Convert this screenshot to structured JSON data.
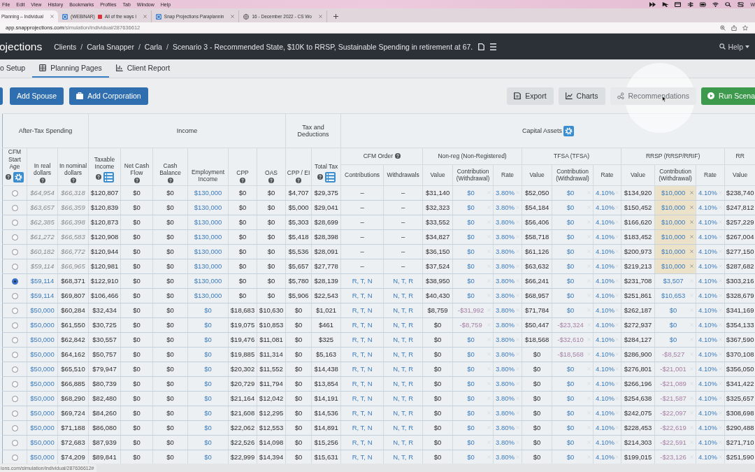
{
  "menu_bar": {
    "items": [
      "File",
      "Edit",
      "View",
      "History",
      "Bookmarks",
      "Profiles",
      "Tab",
      "Window",
      "Help"
    ],
    "status_text": "W"
  },
  "browser_tabs": [
    {
      "title_parts": [
        "Planning – Individual"
      ],
      "selected": true
    },
    {
      "title_parts": [
        "(WEBINAR)",
        "All of the ways i"
      ],
      "selected": false
    },
    {
      "title_parts": [
        "Snap Projections Paraplannin"
      ],
      "selected": false
    },
    {
      "title_parts": [
        "16 - December 2022 - CS Wo"
      ],
      "selected": false
    }
  ],
  "address_bar": {
    "host": "app.snapprojections.com",
    "path": "/simulation/individual/287636612"
  },
  "app_header": {
    "logo": "ojections",
    "breadcrumb": [
      {
        "label": "Clients",
        "separator": "/"
      },
      {
        "label": "Carla Snapper",
        "separator": "/"
      },
      {
        "label": "Carla",
        "separator": "/"
      },
      {
        "label": "Scenario 3 - Recommended State, $10K to RRSP, Sustainable Spending in retirement at 67."
      }
    ],
    "help": "Help"
  },
  "nav_tabs": [
    {
      "label": "o Setup",
      "selected": false
    },
    {
      "label": "Planning Pages",
      "selected": true
    },
    {
      "label": "Client Report",
      "selected": false
    }
  ],
  "toolbar": {
    "left": [
      {
        "label": "Add Spouse"
      },
      {
        "label": "Add Corporation"
      }
    ],
    "right": [
      {
        "label": "Export",
        "kind": "secondary",
        "disabled": false
      },
      {
        "label": "Charts",
        "kind": "secondary",
        "disabled": false
      },
      {
        "label": "Recommendations",
        "kind": "secondary",
        "disabled": true
      },
      {
        "label": "Run Scena",
        "kind": "success",
        "disabled": false
      }
    ]
  },
  "table": {
    "groups": [
      {
        "label": "After-Tax Spending",
        "columns": [
          {
            "label": "CFM Start Age",
            "help": true,
            "kind": "radio"
          },
          {
            "label": "In real dollars",
            "help": true,
            "kind": "spending"
          },
          {
            "label": "In nominal dollars",
            "help": true,
            "kind": "nominal"
          }
        ]
      },
      {
        "label": "Income",
        "columns": [
          {
            "label": "Taxable Income",
            "help": true,
            "kind": "amount"
          },
          {
            "label": "Net Cash Flow",
            "help": true,
            "kind": "amount"
          },
          {
            "label": "Cash Balance",
            "help": true,
            "kind": "amount"
          },
          {
            "label": "Employment Income",
            "help": false,
            "kind": "input"
          },
          {
            "label": "CPP",
            "help": true,
            "kind": "amount"
          },
          {
            "label": "OAS",
            "help": true,
            "kind": "amount"
          }
        ]
      },
      {
        "label": "Tax and Deductions",
        "columns": [
          {
            "label": "CPP / EI",
            "help": true,
            "kind": "amount"
          },
          {
            "label": "Total Tax",
            "help": true,
            "kind": "amount"
          }
        ]
      },
      {
        "label": "Capital Assets",
        "subgroups": [
          {
            "label": "CFM Order",
            "help": true,
            "columns": [
              {
                "label": "Contributions",
                "kind": "order"
              },
              {
                "label": "Withdrawals",
                "kind": "order"
              }
            ]
          },
          {
            "label": "Non-reg (Non-Registered)",
            "help": false,
            "columns": [
              {
                "label": "Value",
                "kind": "amount"
              },
              {
                "label": "Contribution (Withdrawal)",
                "kind": "contribution"
              },
              {
                "label": "Rate",
                "kind": "rate"
              }
            ]
          },
          {
            "label": "TFSA (TFSA)",
            "help": false,
            "columns": [
              {
                "label": "Value",
                "kind": "amount"
              },
              {
                "label": "Contribution (Withdrawal)",
                "kind": "contribution"
              },
              {
                "label": "Rate",
                "kind": "rate"
              }
            ]
          },
          {
            "label": "RRSP (RRSP/RRIF)",
            "help": false,
            "columns": [
              {
                "label": "Value",
                "kind": "amount"
              },
              {
                "label": "Contribution (Withdrawal)",
                "kind": "contribution"
              },
              {
                "label": "Rate",
                "kind": "rate"
              }
            ]
          },
          {
            "label": "RR",
            "help": false,
            "columns": [
              {
                "label": "Value",
                "kind": "amount"
              }
            ]
          }
        ]
      }
    ],
    "rows": [
      {
        "selected": false,
        "before_start": true,
        "cells": [
          "$64,954",
          "$66,318",
          "$120,807",
          "$0",
          "$0",
          "$130,000",
          "$0",
          "$0",
          "$4,707",
          "$29,375",
          "–",
          "–",
          "$31,140",
          {
            "value": "$0",
            "withdrawal": false,
            "override": false
          },
          "3.80%",
          "$52,050",
          {
            "value": "$0",
            "withdrawal": false,
            "override": false
          },
          "4.10%",
          "$134,920",
          {
            "value": "$10,000",
            "withdrawal": false,
            "override": true
          },
          "4.10%",
          "$238,740"
        ]
      },
      {
        "selected": false,
        "before_start": true,
        "cells": [
          "$63,657",
          "$66,359",
          "$120,839",
          "$0",
          "$0",
          "$130,000",
          "$0",
          "$0",
          "$5,000",
          "$29,041",
          "–",
          "–",
          "$32,323",
          {
            "value": "$0",
            "withdrawal": false,
            "override": false
          },
          "3.80%",
          "$54,184",
          {
            "value": "$0",
            "withdrawal": false,
            "override": false
          },
          "4.10%",
          "$150,452",
          {
            "value": "$10,000",
            "withdrawal": false,
            "override": true
          },
          "4.10%",
          "$247,812"
        ]
      },
      {
        "selected": false,
        "before_start": true,
        "cells": [
          "$62,385",
          "$66,398",
          "$120,873",
          "$0",
          "$0",
          "$130,000",
          "$0",
          "$0",
          "$5,303",
          "$28,699",
          "–",
          "–",
          "$33,552",
          {
            "value": "$0",
            "withdrawal": false,
            "override": false
          },
          "3.80%",
          "$56,406",
          {
            "value": "$0",
            "withdrawal": false,
            "override": false
          },
          "4.10%",
          "$166,620",
          {
            "value": "$10,000",
            "withdrawal": false,
            "override": true
          },
          "4.10%",
          "$257,229"
        ]
      },
      {
        "selected": false,
        "before_start": true,
        "cells": [
          "$61,272",
          "$66,583",
          "$120,908",
          "$0",
          "$0",
          "$130,000",
          "$0",
          "$0",
          "$5,418",
          "$28,398",
          "–",
          "–",
          "$34,827",
          {
            "value": "$0",
            "withdrawal": false,
            "override": false
          },
          "3.80%",
          "$58,718",
          {
            "value": "$0",
            "withdrawal": false,
            "override": false
          },
          "4.10%",
          "$183,452",
          {
            "value": "$10,000",
            "withdrawal": false,
            "override": true
          },
          "4.10%",
          "$267,004"
        ]
      },
      {
        "selected": false,
        "before_start": true,
        "cells": [
          "$60,182",
          "$66,772",
          "$120,944",
          "$0",
          "$0",
          "$130,000",
          "$0",
          "$0",
          "$5,536",
          "$28,091",
          "–",
          "–",
          "$36,150",
          {
            "value": "$0",
            "withdrawal": false,
            "override": false
          },
          "3.80%",
          "$61,126",
          {
            "value": "$0",
            "withdrawal": false,
            "override": false
          },
          "4.10%",
          "$200,973",
          {
            "value": "$10,000",
            "withdrawal": false,
            "override": true
          },
          "4.10%",
          "$277,150"
        ]
      },
      {
        "selected": false,
        "before_start": true,
        "cells": [
          "$59,114",
          "$66,965",
          "$120,981",
          "$0",
          "$0",
          "$130,000",
          "$0",
          "$0",
          "$5,657",
          "$27,778",
          "–",
          "–",
          "$37,524",
          {
            "value": "$0",
            "withdrawal": false,
            "override": false
          },
          "3.80%",
          "$63,632",
          {
            "value": "$0",
            "withdrawal": false,
            "override": false
          },
          "4.10%",
          "$219,213",
          {
            "value": "$10,000",
            "withdrawal": false,
            "override": true
          },
          "4.10%",
          "$287,682"
        ]
      },
      {
        "selected": true,
        "before_start": false,
        "cells": [
          "$59,114",
          "$68,371",
          "$122,910",
          "$0",
          "$0",
          "$130,000",
          "$0",
          "$0",
          "$5,780",
          "$28,139",
          "R, T, N",
          "N, T, R",
          "$38,950",
          {
            "value": "$0",
            "withdrawal": false,
            "override": false
          },
          "3.80%",
          "$66,241",
          {
            "value": "$0",
            "withdrawal": false,
            "override": false
          },
          "4.10%",
          "$231,708",
          {
            "value": "$3,507",
            "withdrawal": false,
            "override": false
          },
          "4.10%",
          "$303,216"
        ]
      },
      {
        "selected": false,
        "before_start": false,
        "cells": [
          "$59,114",
          "$69,807",
          "$106,466",
          "$0",
          "$0",
          "$130,000",
          "$0",
          "$0",
          "$5,906",
          "$22,543",
          "R, T, N",
          "N, T, R",
          "$40,430",
          {
            "value": "$0",
            "withdrawal": false,
            "override": false
          },
          "3.80%",
          "$68,957",
          {
            "value": "$0",
            "withdrawal": false,
            "override": false
          },
          "4.10%",
          "$251,861",
          {
            "value": "$10,653",
            "withdrawal": false,
            "override": false
          },
          "4.10%",
          "$328,679"
        ]
      },
      {
        "selected": false,
        "before_start": false,
        "cells": [
          "$50,000",
          "$60,284",
          "$32,434",
          "$0",
          "$0",
          "$0",
          "$18,683",
          "$10,630",
          "$0",
          "$1,021",
          "R, T, N",
          "N, T, R",
          "$8,759",
          {
            "value": "-$31,992",
            "withdrawal": true,
            "override": false
          },
          "3.80%",
          "$71,784",
          {
            "value": "$0",
            "withdrawal": false,
            "override": false
          },
          "4.10%",
          "$262,187",
          {
            "value": "$0",
            "withdrawal": false,
            "override": false
          },
          "4.10%",
          "$341,169"
        ]
      },
      {
        "selected": false,
        "before_start": false,
        "cells": [
          "$50,000",
          "$61,550",
          "$30,725",
          "$0",
          "$0",
          "$0",
          "$19,075",
          "$10,853",
          "$0",
          "$461",
          "R, T, N",
          "N, T, R",
          "$0",
          {
            "value": "-$8,759",
            "withdrawal": true,
            "override": false
          },
          "3.80%",
          "$50,447",
          {
            "value": "-$23,324",
            "withdrawal": true,
            "override": false
          },
          "4.10%",
          "$272,937",
          {
            "value": "$0",
            "withdrawal": false,
            "override": false
          },
          "4.10%",
          "$354,133"
        ]
      },
      {
        "selected": false,
        "before_start": false,
        "cells": [
          "$50,000",
          "$62,842",
          "$30,557",
          "$0",
          "$0",
          "$0",
          "$19,476",
          "$11,081",
          "$0",
          "$325",
          "R, T, N",
          "N, T, R",
          "$0",
          {
            "value": "$0",
            "withdrawal": false,
            "override": false
          },
          "3.80%",
          "$18,568",
          {
            "value": "-$32,610",
            "withdrawal": true,
            "override": false
          },
          "4.10%",
          "$284,127",
          {
            "value": "$0",
            "withdrawal": false,
            "override": false
          },
          "4.10%",
          "$367,590"
        ]
      },
      {
        "selected": false,
        "before_start": false,
        "cells": [
          "$50,000",
          "$64,162",
          "$50,757",
          "$0",
          "$0",
          "$0",
          "$19,885",
          "$11,314",
          "$0",
          "$5,163",
          "R, T, N",
          "N, T, R",
          "$0",
          {
            "value": "$0",
            "withdrawal": false,
            "override": false
          },
          "3.80%",
          "$0",
          {
            "value": "-$18,568",
            "withdrawal": true,
            "override": false
          },
          "4.10%",
          "$286,900",
          {
            "value": "-$8,527",
            "withdrawal": true,
            "override": false
          },
          "4.10%",
          "$370,108"
        ]
      },
      {
        "selected": false,
        "before_start": false,
        "cells": [
          "$50,000",
          "$65,510",
          "$79,947",
          "$0",
          "$0",
          "$0",
          "$20,302",
          "$11,552",
          "$0",
          "$14,438",
          "R, T, N",
          "N, T, R",
          "$0",
          {
            "value": "$0",
            "withdrawal": false,
            "override": false
          },
          "3.80%",
          "$0",
          {
            "value": "$0",
            "withdrawal": false,
            "override": false
          },
          "4.10%",
          "$276,801",
          {
            "value": "-$21,001",
            "withdrawal": true,
            "override": false
          },
          "4.10%",
          "$356,050"
        ]
      },
      {
        "selected": false,
        "before_start": false,
        "cells": [
          "$50,000",
          "$66,885",
          "$80,739",
          "$0",
          "$0",
          "$0",
          "$20,729",
          "$11,794",
          "$0",
          "$13,854",
          "R, T, N",
          "N, T, R",
          "$0",
          {
            "value": "$0",
            "withdrawal": false,
            "override": false
          },
          "3.80%",
          "$0",
          {
            "value": "$0",
            "withdrawal": false,
            "override": false
          },
          "4.10%",
          "$266,196",
          {
            "value": "-$21,089",
            "withdrawal": true,
            "override": false
          },
          "4.10%",
          "$341,422"
        ]
      },
      {
        "selected": false,
        "before_start": false,
        "cells": [
          "$50,000",
          "$68,290",
          "$82,480",
          "$0",
          "$0",
          "$0",
          "$21,164",
          "$12,042",
          "$0",
          "$14,191",
          "R, T, N",
          "N, T, R",
          "$0",
          {
            "value": "$0",
            "withdrawal": false,
            "override": false
          },
          "3.80%",
          "$0",
          {
            "value": "$0",
            "withdrawal": false,
            "override": false
          },
          "4.10%",
          "$254,638",
          {
            "value": "-$21,587",
            "withdrawal": true,
            "override": false
          },
          "4.10%",
          "$325,657"
        ]
      },
      {
        "selected": false,
        "before_start": false,
        "cells": [
          "$50,000",
          "$69,724",
          "$84,260",
          "$0",
          "$0",
          "$0",
          "$21,608",
          "$12,295",
          "$0",
          "$14,536",
          "R, T, N",
          "N, T, R",
          "$0",
          {
            "value": "$0",
            "withdrawal": false,
            "override": false
          },
          "3.80%",
          "$0",
          {
            "value": "$0",
            "withdrawal": false,
            "override": false
          },
          "4.10%",
          "$242,075",
          {
            "value": "-$22,097",
            "withdrawal": true,
            "override": false
          },
          "4.10%",
          "$308,698"
        ]
      },
      {
        "selected": false,
        "before_start": false,
        "cells": [
          "$50,000",
          "$71,188",
          "$86,080",
          "$0",
          "$0",
          "$0",
          "$22,062",
          "$12,553",
          "$0",
          "$14,891",
          "R, T, N",
          "N, T, R",
          "$0",
          {
            "value": "$0",
            "withdrawal": false,
            "override": false
          },
          "3.80%",
          "$0",
          {
            "value": "$0",
            "withdrawal": false,
            "override": false
          },
          "4.10%",
          "$228,453",
          {
            "value": "-$22,619",
            "withdrawal": true,
            "override": false
          },
          "4.10%",
          "$290,488"
        ]
      },
      {
        "selected": false,
        "before_start": false,
        "cells": [
          "$50,000",
          "$72,683",
          "$87,939",
          "$0",
          "$0",
          "$0",
          "$22,526",
          "$14,098",
          "$0",
          "$15,256",
          "R, T, N",
          "N, T, R",
          "$0",
          {
            "value": "$0",
            "withdrawal": false,
            "override": false
          },
          "3.80%",
          "$0",
          {
            "value": "$0",
            "withdrawal": false,
            "override": false
          },
          "4.10%",
          "$214,303",
          {
            "value": "-$22,591",
            "withdrawal": true,
            "override": false
          },
          "4.10%",
          "$271,710"
        ]
      },
      {
        "selected": false,
        "before_start": false,
        "cells": [
          "$50,000",
          "$74,209",
          "$89,841",
          "$0",
          "$0",
          "$0",
          "$22,999",
          "$14,394",
          "$0",
          "$15,631",
          "R, T, N",
          "N, T, R",
          "$0",
          {
            "value": "$0",
            "withdrawal": false,
            "override": false
          },
          "3.80%",
          "$0",
          {
            "value": "$0",
            "withdrawal": false,
            "override": false
          },
          "4.10%",
          "$199,015",
          {
            "value": "-$23,126",
            "withdrawal": true,
            "override": false
          },
          "4.10%",
          "$251,590"
        ]
      }
    ]
  },
  "status_bubble": {
    "url": "ions.com/simulation/individual/287636612#"
  }
}
